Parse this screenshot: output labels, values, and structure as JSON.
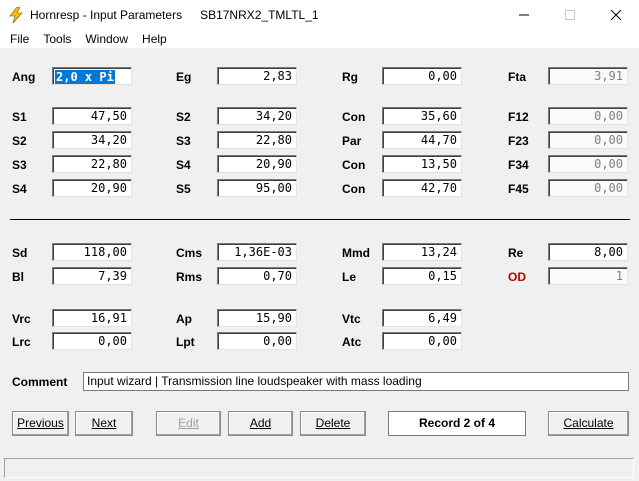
{
  "window": {
    "app_name": "Hornresp - Input Parameters",
    "document": "SB17NRX2_TMLTL_1"
  },
  "menu": [
    "File",
    "Tools",
    "Window",
    "Help"
  ],
  "fields": {
    "ang": {
      "label": "Ang",
      "value": "2,0 x Pi"
    },
    "eg": {
      "label": "Eg",
      "value": "2,83"
    },
    "rg": {
      "label": "Rg",
      "value": "0,00"
    },
    "fta": {
      "label": "Fta",
      "value": "3,91"
    },
    "s1": {
      "label": "S1",
      "value": "47,50"
    },
    "s2b": {
      "label": "S2",
      "value": "34,20"
    },
    "con1": {
      "label": "Con",
      "value": "35,60"
    },
    "f12": {
      "label": "F12",
      "value": "0,00"
    },
    "s2": {
      "label": "S2",
      "value": "34,20"
    },
    "s3b": {
      "label": "S3",
      "value": "22,80"
    },
    "par": {
      "label": "Par",
      "value": "44,70"
    },
    "f23": {
      "label": "F23",
      "value": "0,00"
    },
    "s3": {
      "label": "S3",
      "value": "22,80"
    },
    "s4b": {
      "label": "S4",
      "value": "20,90"
    },
    "con2": {
      "label": "Con",
      "value": "13,50"
    },
    "f34": {
      "label": "F34",
      "value": "0,00"
    },
    "s4": {
      "label": "S4",
      "value": "20,90"
    },
    "s5": {
      "label": "S5",
      "value": "95,00"
    },
    "con3": {
      "label": "Con",
      "value": "42,70"
    },
    "f45": {
      "label": "F45",
      "value": "0,00"
    },
    "sd": {
      "label": "Sd",
      "value": "118,00"
    },
    "cms": {
      "label": "Cms",
      "value": "1,36E-03"
    },
    "mmd": {
      "label": "Mmd",
      "value": "13,24"
    },
    "re": {
      "label": "Re",
      "value": "8,00"
    },
    "bl": {
      "label": "Bl",
      "value": "7,39"
    },
    "rms": {
      "label": "Rms",
      "value": "0,70"
    },
    "le": {
      "label": "Le",
      "value": "0,15"
    },
    "od": {
      "label": "OD",
      "value": "1"
    },
    "vrc": {
      "label": "Vrc",
      "value": "16,91"
    },
    "ap": {
      "label": "Ap",
      "value": "15,90"
    },
    "vtc": {
      "label": "Vtc",
      "value": "6,49"
    },
    "lrc": {
      "label": "Lrc",
      "value": "0,00"
    },
    "lpt": {
      "label": "Lpt",
      "value": "0,00"
    },
    "atc": {
      "label": "Atc",
      "value": "0,00"
    }
  },
  "comment": {
    "label": "Comment",
    "value": "Input wizard | Transmission line loudspeaker with mass loading"
  },
  "buttons": {
    "previous": "Previous",
    "next": "Next",
    "edit": "Edit",
    "add": "Add",
    "delete": "Delete",
    "calculate": "Calculate"
  },
  "record": "Record 2 of 4",
  "colors": {
    "selection": "#0078d7",
    "od_label": "#c00000",
    "disabled_text": "#7f7f7f"
  }
}
